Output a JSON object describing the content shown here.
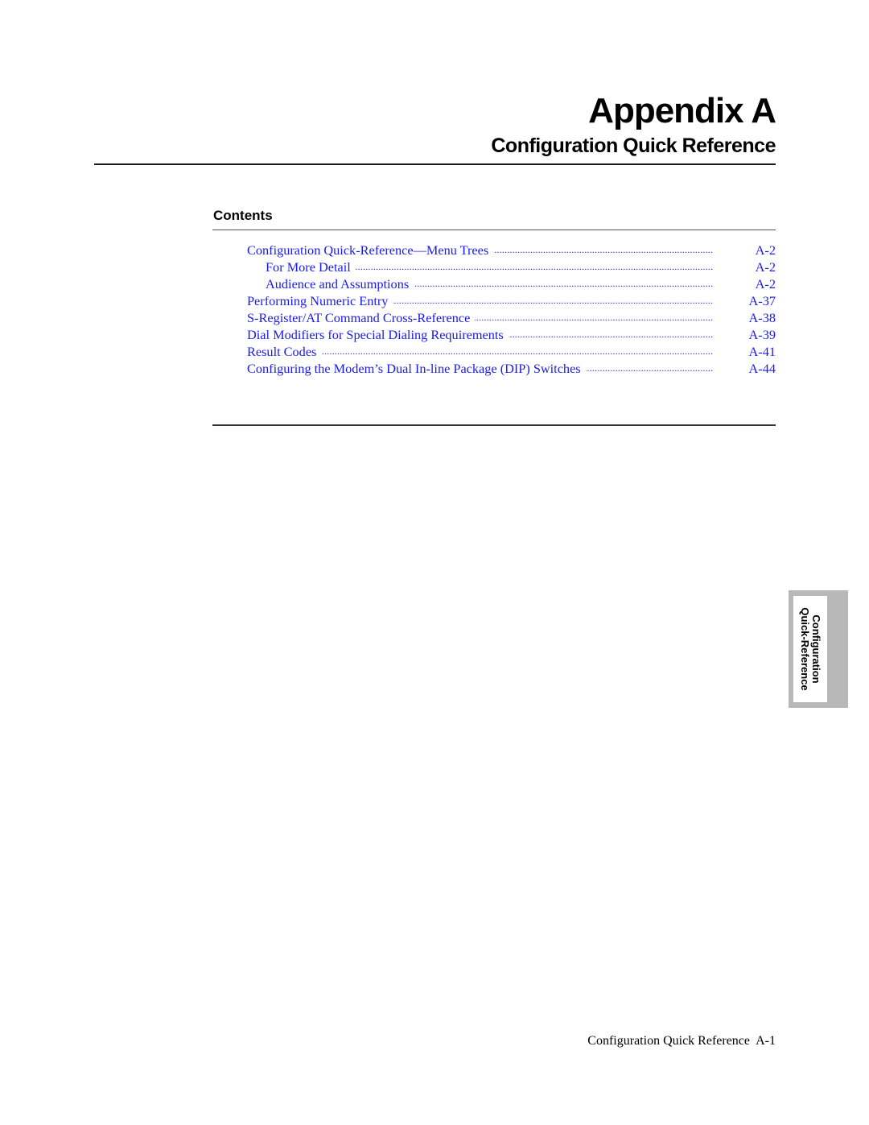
{
  "header": {
    "title": "Appendix A",
    "subtitle": "Configuration Quick Reference"
  },
  "contents": {
    "heading": "Contents",
    "link_color": "#1a1aee",
    "entries": [
      {
        "label": "Configuration Quick-Reference—Menu Trees",
        "page": "A-2",
        "indent": false
      },
      {
        "label": "For More Detail",
        "page": "A-2",
        "indent": true
      },
      {
        "label": "Audience and Assumptions",
        "page": "A-2",
        "indent": true
      },
      {
        "label": "Performing Numeric Entry",
        "page": "A-37",
        "indent": false
      },
      {
        "label": "S-Register/AT Command Cross-Reference",
        "page": "A-38",
        "indent": false
      },
      {
        "label": "Dial Modifiers for Special Dialing Requirements",
        "page": "A-39",
        "indent": false
      },
      {
        "label": "Result Codes",
        "page": "A-41",
        "indent": false
      },
      {
        "label": "Configuring the Modem’s Dual In-line Package (DIP) Switches",
        "page": "A-44",
        "indent": false
      }
    ]
  },
  "side_tab": {
    "line1": "Configuration",
    "line2": "Quick-Reference"
  },
  "footer": {
    "text": "Configuration Quick Reference  A-1"
  }
}
